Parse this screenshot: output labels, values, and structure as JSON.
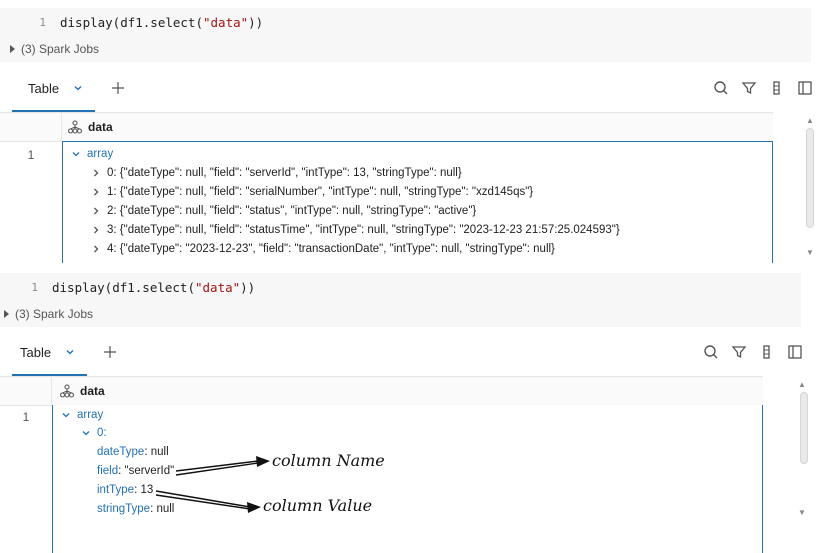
{
  "top": {
    "code": {
      "line_number": "1",
      "prefix": "display(df1.select(",
      "string": "\"data\"",
      "suffix": "))"
    },
    "jobs_label": "(3) Spark Jobs",
    "tab_label": "Table",
    "column_header": "data",
    "row_number": "1",
    "array_label": "array",
    "items": [
      "0: {\"dateType\": null, \"field\": \"serverId\", \"intType\": 13, \"stringType\": null}",
      "1: {\"dateType\": null, \"field\": \"serialNumber\", \"intType\": null, \"stringType\": \"xzd145qs\"}",
      "2: {\"dateType\": null, \"field\": \"status\", \"intType\": null, \"stringType\": \"active\"}",
      "3: {\"dateType\": null, \"field\": \"statusTime\", \"intType\": null, \"stringType\": \"2023-12-23 21:57:25.024593\"}",
      "4: {\"dateType\": \"2023-12-23\", \"field\": \"transactionDate\", \"intType\": null, \"stringType\": null}"
    ]
  },
  "bottom": {
    "code": {
      "line_number": "1",
      "prefix": "display(df1.select(",
      "string": "\"data\"",
      "suffix": "))"
    },
    "jobs_label": "(3) Spark Jobs",
    "tab_label": "Table",
    "column_header": "data",
    "row_number": "1",
    "array_label": "array",
    "index_label": "0:",
    "fields": [
      {
        "key": "dateType",
        "value": "null"
      },
      {
        "key": "field",
        "value": "\"serverId\""
      },
      {
        "key": "intType",
        "value": "13"
      },
      {
        "key": "stringType",
        "value": "null"
      }
    ],
    "annotations": {
      "column_name": "column Name",
      "column_value": "column Value"
    }
  },
  "icons": {
    "search": "search-icon",
    "filter": "filter-icon",
    "columns": "column-settings-icon",
    "sidebar": "sidebar-panel-icon"
  },
  "colors": {
    "accent": "#2272b4",
    "code_bg": "#f7f7f7",
    "string": "#a31515"
  }
}
